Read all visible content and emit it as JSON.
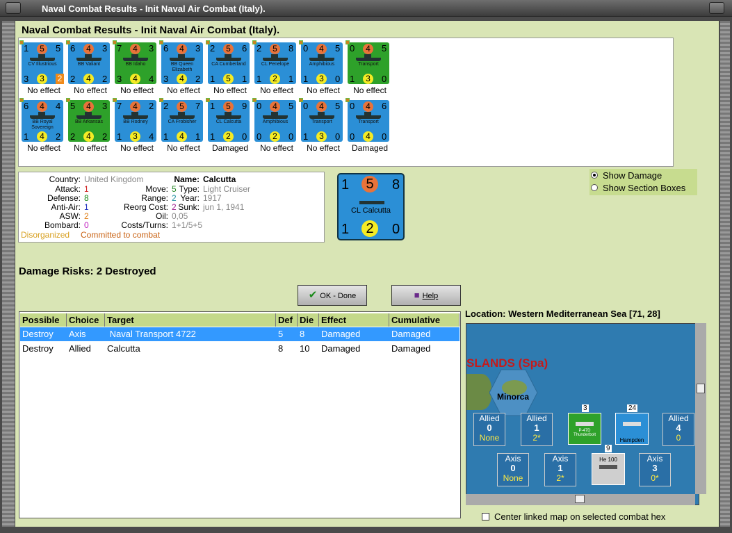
{
  "window": {
    "title": "Naval Combat Results - Init Naval Air Combat (Italy)."
  },
  "panel_title": "Naval Combat Results - Init Naval Air Combat (Italy).",
  "units_row1": [
    {
      "tl": "1",
      "mid": "5",
      "tr": "5",
      "name": "CV Illustrious",
      "bl": "3",
      "circ": "3",
      "br": "2",
      "color": "blue",
      "effect": "No effect",
      "badge": true
    },
    {
      "tl": "6",
      "mid": "4",
      "tr": "3",
      "name": "BB Valiant",
      "bl": "2",
      "circ": "4",
      "br": "2",
      "color": "blue",
      "effect": "No effect"
    },
    {
      "tl": "7",
      "mid": "4",
      "tr": "3",
      "name": "BB Idaho",
      "bl": "3",
      "circ": "4",
      "br": "4",
      "color": "green",
      "effect": "No effect"
    },
    {
      "tl": "6",
      "mid": "4",
      "tr": "3",
      "name": "BB Queen Elizabeth",
      "bl": "3",
      "circ": "4",
      "br": "2",
      "color": "blue",
      "effect": "No effect"
    },
    {
      "tl": "2",
      "mid": "5",
      "tr": "6",
      "name": "CA Cumberland",
      "bl": "1",
      "circ": "5",
      "br": "1",
      "color": "blue",
      "effect": "No effect"
    },
    {
      "tl": "2",
      "mid": "5",
      "tr": "8",
      "name": "CL Penelope",
      "bl": "1",
      "circ": "2",
      "br": "1",
      "color": "blue",
      "effect": "No effect"
    },
    {
      "tl": "0",
      "mid": "4",
      "tr": "5",
      "name": "Amphibious",
      "bl": "1",
      "circ": "3",
      "br": "0",
      "color": "blue",
      "effect": "No effect"
    },
    {
      "tl": "0",
      "mid": "4",
      "tr": "5",
      "name": "Transport",
      "bl": "1",
      "circ": "3",
      "br": "0",
      "color": "green",
      "effect": "No effect"
    }
  ],
  "units_row2": [
    {
      "tl": "6",
      "mid": "4",
      "tr": "4",
      "name": "BB Royal Sovereign",
      "bl": "1",
      "circ": "4",
      "br": "2",
      "color": "blue",
      "effect": "No effect"
    },
    {
      "tl": "5",
      "mid": "4",
      "tr": "3",
      "name": "BB Arkansas",
      "bl": "2",
      "circ": "4",
      "br": "2",
      "color": "green",
      "effect": "No effect"
    },
    {
      "tl": "7",
      "mid": "4",
      "tr": "2",
      "name": "BB Rodney",
      "bl": "1",
      "circ": "3",
      "br": "4",
      "color": "blue",
      "effect": "No effect"
    },
    {
      "tl": "2",
      "mid": "5",
      "tr": "7",
      "name": "CA Frobisher",
      "bl": "1",
      "circ": "4",
      "br": "1",
      "color": "blue",
      "effect": "No effect"
    },
    {
      "tl": "1",
      "mid": "5",
      "tr": "9",
      "name": "CL Calcutta",
      "bl": "1",
      "circ": "2",
      "br": "0",
      "color": "blue",
      "effect": "Damaged"
    },
    {
      "tl": "0",
      "mid": "4",
      "tr": "5",
      "name": "Amphibious",
      "bl": "0",
      "circ": "2",
      "br": "0",
      "color": "blue",
      "effect": "No effect"
    },
    {
      "tl": "0",
      "mid": "4",
      "tr": "5",
      "name": "Transport",
      "bl": "1",
      "circ": "3",
      "br": "0",
      "color": "blue",
      "effect": "No effect"
    },
    {
      "tl": "0",
      "mid": "4",
      "tr": "6",
      "name": "Transport",
      "bl": "0",
      "circ": "4",
      "br": "0",
      "color": "blue",
      "effect": "Damaged"
    }
  ],
  "info": {
    "country_label": "Country:",
    "country": "United Kingdom",
    "attack_label": "Attack:",
    "attack": "1",
    "defense_label": "Defense:",
    "defense": "8",
    "antiair_label": "Anti-Air:",
    "antiair": "1",
    "asw_label": "ASW:",
    "asw": "2",
    "bombard_label": "Bombard:",
    "bombard": "0",
    "name_label": "Name:",
    "name": "Calcutta",
    "type_label": "Type:",
    "type": "Light Cruiser",
    "year_label": "Year:",
    "year": "1917",
    "sunk_label": "Sunk:",
    "sunk": "jun 1, 1941",
    "move_label": "Move:",
    "move": "5",
    "range_label": "Range:",
    "range": "2",
    "reorg_label": "Reorg Cost:",
    "reorg": "2",
    "oil_label": "Oil:",
    "oil": "0,05",
    "costs_label": "Costs/Turns:",
    "costs": "1+1/5+5",
    "status1": "Disorganized",
    "status2": "Committed to combat"
  },
  "big_counter": {
    "tl": "1",
    "mid": "5",
    "tr": "8",
    "name": "CL Calcutta",
    "bl": "1",
    "circ": "2",
    "br": "0"
  },
  "options": {
    "show_damage": "Show Damage",
    "show_sections": "Show Section Boxes"
  },
  "damage_risks": "Damage Risks:  2 Destroyed",
  "buttons": {
    "ok": "OK - Done",
    "help": "Help"
  },
  "table": {
    "headers": [
      "Possible",
      "Choice",
      "Target",
      "Def",
      "Die",
      "Effect",
      "Cumulative"
    ],
    "rows": [
      [
        "Destroy",
        "Axis",
        " Naval Transport 4722",
        "5",
        "8",
        "Damaged",
        "Damaged"
      ],
      [
        "Destroy",
        "Allied",
        "Calcutta",
        "8",
        "10",
        "Damaged",
        "Damaged"
      ]
    ]
  },
  "location": "Location:  Western Mediterranean Sea [71, 28]",
  "map": {
    "label": "SLANDS (Spa)",
    "island": "Minorca",
    "allied": [
      {
        "side": "Allied",
        "n": "0",
        "sub": "None"
      },
      {
        "side": "Allied",
        "n": "1",
        "sub": "2*"
      },
      {
        "side": "Allied",
        "n": "4",
        "sub": "0"
      }
    ],
    "axis": [
      {
        "side": "Axis",
        "n": "0",
        "sub": "None"
      },
      {
        "side": "Axis",
        "n": "1",
        "sub": "2*"
      },
      {
        "side": "Axis",
        "n": "3",
        "sub": "0*"
      }
    ],
    "stack_counts": [
      "3",
      "24",
      "9"
    ],
    "aircraft": [
      "P-47D Thunderbolt",
      "Hampden",
      "He 100"
    ]
  },
  "center_linked": "Center linked map on selected combat hex"
}
